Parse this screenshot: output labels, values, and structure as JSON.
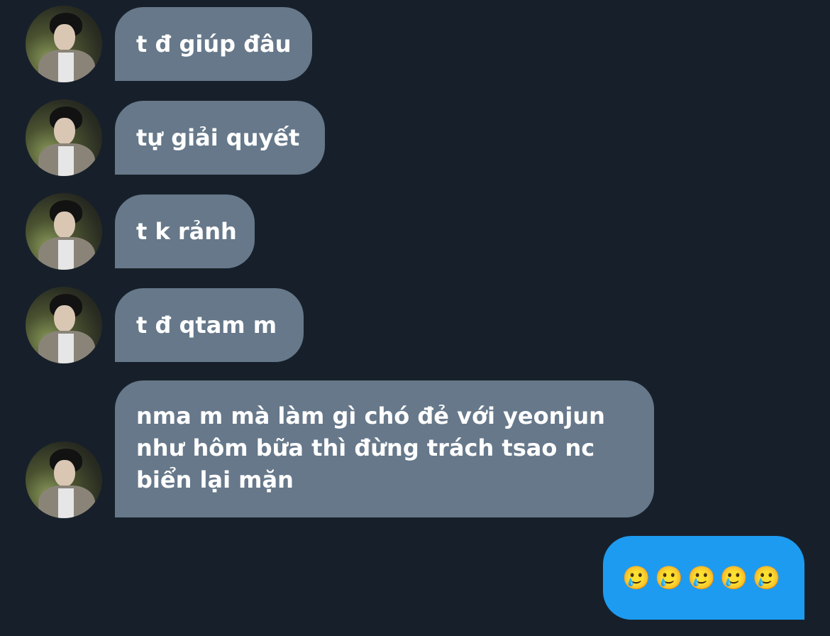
{
  "messages": [
    {
      "direction": "incoming",
      "text": "t đ giúp đâu"
    },
    {
      "direction": "incoming",
      "text": "tự giải quyết"
    },
    {
      "direction": "incoming",
      "text": "t k rảnh"
    },
    {
      "direction": "incoming",
      "text": "t đ qtam m"
    },
    {
      "direction": "incoming",
      "lines": [
        "nma m mà làm gì chó đẻ với yeonjun",
        "như hôm bữa thì đừng trách tsao nc",
        "biển lại mặn"
      ]
    },
    {
      "direction": "outgoing",
      "text": "🥲🥲🥲🥲🥲"
    }
  ],
  "colors": {
    "background": "#17202a",
    "incoming_bubble": "#66788a",
    "outgoing_bubble": "#1d9bf0",
    "text": "#ffffff"
  },
  "icons": {
    "avatar": "user-avatar"
  }
}
